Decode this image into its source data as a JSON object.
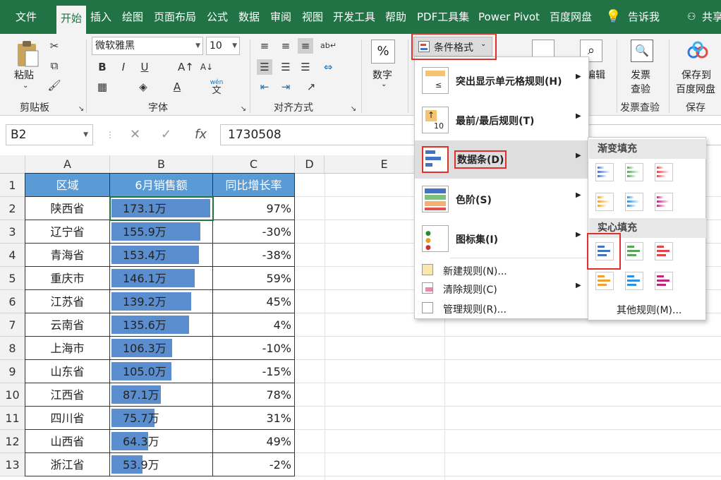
{
  "tabs": [
    "文件",
    "开始",
    "插入",
    "绘图",
    "页面布局",
    "公式",
    "数据",
    "审阅",
    "视图",
    "开发工具",
    "帮助",
    "PDF工具集",
    "Power Pivot",
    "百度网盘",
    "告诉我",
    "共享"
  ],
  "ribbon": {
    "paste": "粘贴",
    "clipboard": "剪贴板",
    "font_name": "微软雅黑",
    "font_size": "10",
    "font_group": "字体",
    "bold": "B",
    "italic": "I",
    "underline": "U",
    "wen": "wén",
    "wen2": "文",
    "align_group": "对齐方式",
    "number": "数字",
    "number_icon": "%",
    "cond_format": "条件格式",
    "edit": "编辑",
    "invoice_check": "发票查验",
    "invoice_line1": "发票",
    "invoice_line2": "查验",
    "invoice_group": "发票查验",
    "save_baidu_line1": "保存到",
    "save_baidu_line2": "百度网盘",
    "save_group": "保存"
  },
  "formula_bar": {
    "name_box": "B2",
    "fx": "fx",
    "value": "1730508"
  },
  "columns": [
    "A",
    "B",
    "C",
    "D",
    "E"
  ],
  "rows": [
    "1",
    "2",
    "3",
    "4",
    "5",
    "6",
    "7",
    "8",
    "9",
    "10",
    "11",
    "12",
    "13"
  ],
  "table": {
    "headers": [
      "区域",
      "6月销售额",
      "同比增长率"
    ],
    "data": [
      {
        "region": "陕西省",
        "sales": "173.1万",
        "bar": 1.0,
        "growth": "97%"
      },
      {
        "region": "辽宁省",
        "sales": "155.9万",
        "bar": 0.9,
        "growth": "-30%"
      },
      {
        "region": "青海省",
        "sales": "153.4万",
        "bar": 0.886,
        "growth": "-38%"
      },
      {
        "region": "重庆市",
        "sales": "146.1万",
        "bar": 0.844,
        "growth": "59%"
      },
      {
        "region": "江苏省",
        "sales": "139.2万",
        "bar": 0.804,
        "growth": "45%"
      },
      {
        "region": "云南省",
        "sales": "135.6万",
        "bar": 0.783,
        "growth": "4%"
      },
      {
        "region": "上海市",
        "sales": "106.3万",
        "bar": 0.614,
        "growth": "-10%"
      },
      {
        "region": "山东省",
        "sales": "105.0万",
        "bar": 0.607,
        "growth": "-15%"
      },
      {
        "region": "江西省",
        "sales": "87.1万",
        "bar": 0.503,
        "growth": "78%"
      },
      {
        "region": "四川省",
        "sales": "75.7万",
        "bar": 0.437,
        "growth": "31%"
      },
      {
        "region": "山西省",
        "sales": "64.3万",
        "bar": 0.371,
        "growth": "49%"
      },
      {
        "region": "浙江省",
        "sales": "53.9万",
        "bar": 0.311,
        "growth": "-2%"
      }
    ]
  },
  "cond_menu": {
    "items": [
      {
        "label": "突出显示单元格规则(H)"
      },
      {
        "label": "最前/最后规则(T)"
      },
      {
        "label": "数据条(D)"
      },
      {
        "label": "色阶(S)"
      },
      {
        "label": "图标集(I)"
      }
    ],
    "icon_10": "10",
    "small_items": [
      {
        "label": "新建规则(N)..."
      },
      {
        "label": "清除规则(C)"
      },
      {
        "label": "管理规则(R)..."
      }
    ]
  },
  "databar_sub": {
    "gradient": "渐变填充",
    "solid": "实心填充",
    "more": "其他规则(M)...",
    "colors": [
      "#4472c4",
      "#59a65a",
      "#e0454a",
      "#f0a030",
      "#2e8fe0",
      "#c0267e"
    ]
  }
}
